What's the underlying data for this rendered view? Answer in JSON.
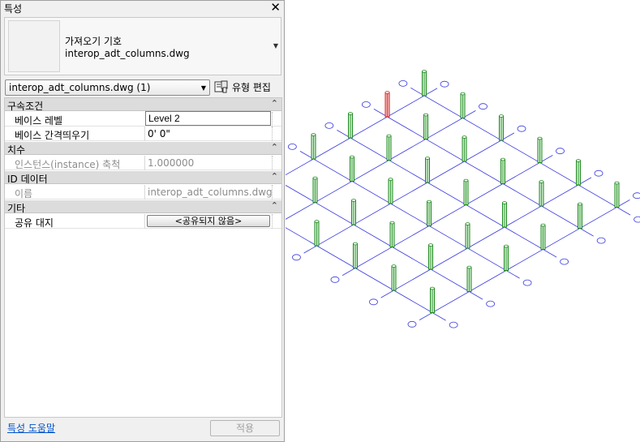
{
  "palette": {
    "title": "특성",
    "type_selector": {
      "family": "가져오기 기호",
      "name": "interop_adt_columns.dwg"
    },
    "instance_filter": "interop_adt_columns.dwg (1)",
    "edit_type_label": "유형 편집",
    "groups": [
      {
        "label": "구속조건",
        "rows": [
          {
            "name": "베이스 레벨",
            "value": "Level 2"
          },
          {
            "name": "베이스 간격띄우기",
            "value": "0'   0\""
          }
        ]
      },
      {
        "label": "치수",
        "rows": [
          {
            "name": "인스턴스(instance) 축척",
            "value": "1.000000"
          }
        ]
      },
      {
        "label": "ID 데이터",
        "rows": [
          {
            "name": "이름",
            "value": "interop_adt_columns.dwg"
          }
        ]
      },
      {
        "label": "기타",
        "rows": [
          {
            "name": "공유 대지",
            "value": "<공유되지 않음>"
          }
        ]
      }
    ],
    "help_link": "특성 도움말",
    "apply_label": "적용"
  },
  "view": {
    "grid_line_color": "#3a3ae0",
    "column_color": "#1e8a1e",
    "selected_column_color": "#e02020",
    "bubble_color": "#3a3ae0"
  }
}
